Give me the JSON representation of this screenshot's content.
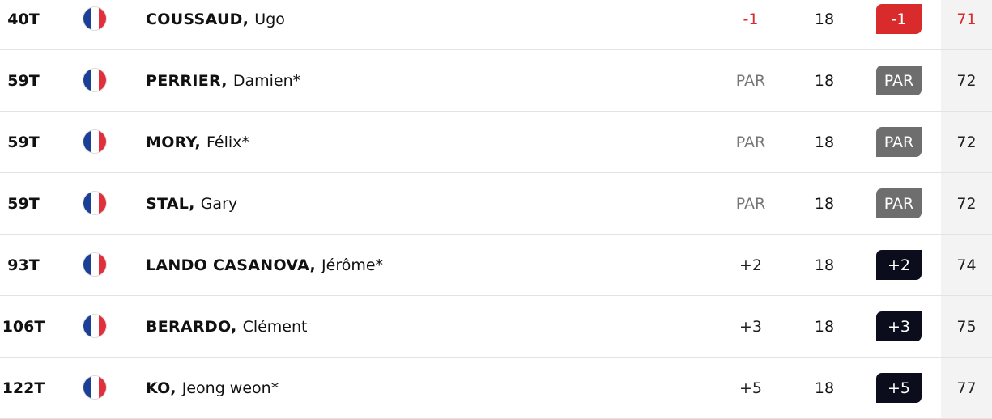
{
  "colors": {
    "under_par": "#d92b2b",
    "even_par_badge": "#6e6e6e",
    "over_par_badge": "#0b0c1c",
    "par_text": "#777777",
    "total_column_bg": "#f3f3f3",
    "flag_france": [
      "#1b3f95",
      "#ffffff",
      "#e0303c"
    ]
  },
  "players": [
    {
      "position": "40T",
      "flag_icon": "france-flag-icon",
      "last_name": "COUSSAUD,",
      "first_name": "Ugo",
      "to_par": "-1",
      "thru": "18",
      "round_score": "-1",
      "total": "71",
      "status": "under"
    },
    {
      "position": "59T",
      "flag_icon": "france-flag-icon",
      "last_name": "PERRIER,",
      "first_name": "Damien*",
      "to_par": "PAR",
      "thru": "18",
      "round_score": "PAR",
      "total": "72",
      "status": "par"
    },
    {
      "position": "59T",
      "flag_icon": "france-flag-icon",
      "last_name": "MORY,",
      "first_name": "Félix*",
      "to_par": "PAR",
      "thru": "18",
      "round_score": "PAR",
      "total": "72",
      "status": "par"
    },
    {
      "position": "59T",
      "flag_icon": "france-flag-icon",
      "last_name": "STAL,",
      "first_name": "Gary",
      "to_par": "PAR",
      "thru": "18",
      "round_score": "PAR",
      "total": "72",
      "status": "par"
    },
    {
      "position": "93T",
      "flag_icon": "france-flag-icon",
      "last_name": "LANDO CASANOVA,",
      "first_name": "Jérôme*",
      "to_par": "+2",
      "thru": "18",
      "round_score": "+2",
      "total": "74",
      "status": "over"
    },
    {
      "position": "106T",
      "flag_icon": "france-flag-icon",
      "last_name": "BERARDO,",
      "first_name": "Clément",
      "to_par": "+3",
      "thru": "18",
      "round_score": "+3",
      "total": "75",
      "status": "over"
    },
    {
      "position": "122T",
      "flag_icon": "france-flag-icon",
      "last_name": "KO,",
      "first_name": "Jeong weon*",
      "to_par": "+5",
      "thru": "18",
      "round_score": "+5",
      "total": "77",
      "status": "over"
    }
  ]
}
